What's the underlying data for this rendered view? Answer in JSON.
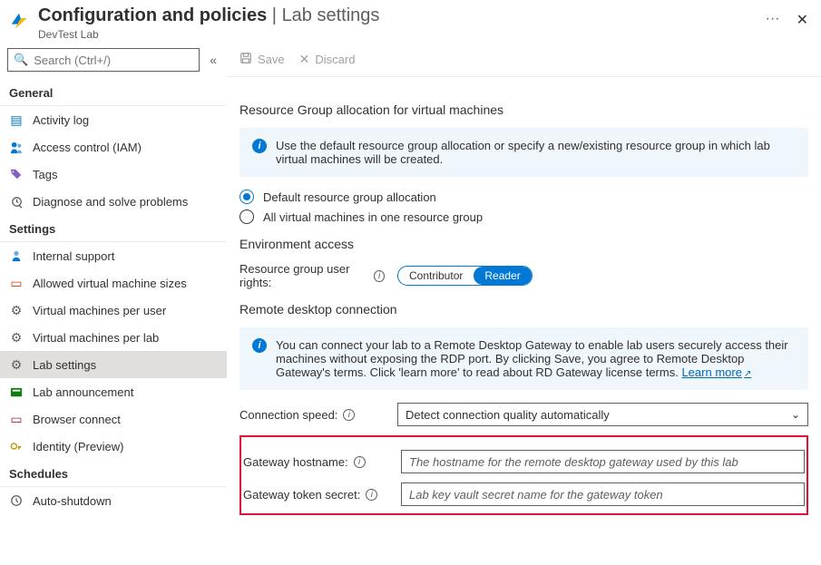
{
  "header": {
    "title_main": "Configuration and policies",
    "title_sub": "Lab settings",
    "type": "DevTest Lab",
    "more": "···"
  },
  "sidebar": {
    "search_placeholder": "Search (Ctrl+/)",
    "groups": {
      "general": "General",
      "settings": "Settings",
      "schedules": "Schedules"
    },
    "items": {
      "activity_log": "Activity log",
      "access_control": "Access control (IAM)",
      "tags": "Tags",
      "diagnose": "Diagnose and solve problems",
      "internal_support": "Internal support",
      "allowed_sizes": "Allowed virtual machine sizes",
      "vms_per_user": "Virtual machines per user",
      "vms_per_lab": "Virtual machines per lab",
      "lab_settings": "Lab settings",
      "lab_announcement": "Lab announcement",
      "browser_connect": "Browser connect",
      "identity": "Identity (Preview)",
      "auto_shutdown": "Auto-shutdown"
    }
  },
  "cmd": {
    "save": "Save",
    "discard": "Discard"
  },
  "main": {
    "rg_alloc": {
      "title": "Resource Group allocation for virtual machines",
      "info": "Use the default resource group allocation or specify a new/existing resource group in which lab virtual machines will be created.",
      "opt_default": "Default resource group allocation",
      "opt_allone": "All virtual machines in one resource group"
    },
    "env_access": {
      "title": "Environment access",
      "rights_label": "Resource group user rights:",
      "contributor": "Contributor",
      "reader": "Reader"
    },
    "rdp": {
      "title": "Remote desktop connection",
      "info": "You can connect your lab to a Remote Desktop Gateway to enable lab users securely access their machines without exposing the RDP port. By clicking Save, you agree to Remote Desktop Gateway's terms.  Click 'learn more' to read about RD Gateway license terms.",
      "learn_more": "Learn more",
      "conn_speed_label": "Connection speed:",
      "conn_speed_value": "Detect connection quality automatically",
      "gw_host_label": "Gateway hostname:",
      "gw_host_placeholder": "The hostname for the remote desktop gateway used by this lab",
      "gw_secret_label": "Gateway token secret:",
      "gw_secret_placeholder": "Lab key vault secret name for the gateway token"
    }
  }
}
